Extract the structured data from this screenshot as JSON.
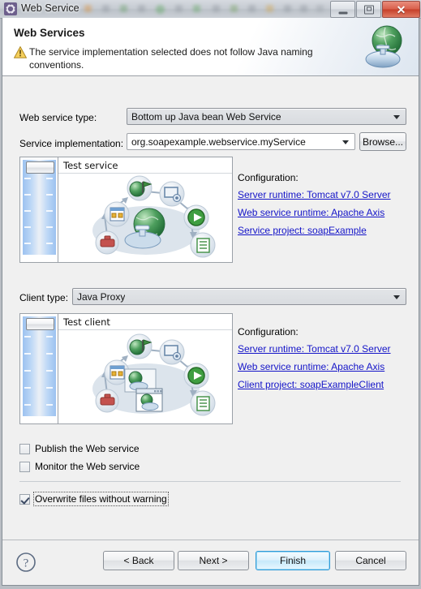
{
  "window": {
    "title": "Web Service",
    "title_icon": "gear-icon",
    "controls": {
      "minimize": "Minimize",
      "maximize": "Maximize",
      "close": "Close"
    }
  },
  "banner": {
    "title": "Web Services",
    "message": "The service implementation selected does not follow Java naming conventions.",
    "warning_icon": "warning-triangle-icon",
    "decoration_icon": "web-service-globe-icon"
  },
  "form": {
    "service_type_label": "Web service type:",
    "service_type_value": "Bottom up Java bean Web Service",
    "service_impl_label": "Service implementation:",
    "service_impl_value": "org.soapexample.webservice.myService",
    "browse_label": "Browse...",
    "client_type_label": "Client type:",
    "client_type_value": "Java Proxy"
  },
  "service_preview": {
    "group_title": "Test service",
    "slider_name": "service-generation-slider"
  },
  "client_preview": {
    "group_title": "Test client",
    "slider_name": "client-generation-slider"
  },
  "service_config": {
    "title": "Configuration:",
    "links": [
      "Server runtime: Tomcat v7.0 Server",
      "Web service runtime: Apache Axis",
      "Service project: soapExample"
    ]
  },
  "client_config": {
    "title": "Configuration:",
    "links": [
      "Server runtime: Tomcat v7.0 Server",
      "Web service runtime: Apache Axis",
      "Client project: soapExampleClient"
    ]
  },
  "options": {
    "publish": {
      "label": "Publish the Web service",
      "checked": false
    },
    "monitor": {
      "label": "Monitor the Web service",
      "checked": false
    },
    "overwrite": {
      "label": "Overwrite files without warning",
      "checked": true
    }
  },
  "footer": {
    "help_icon": "help-question-icon",
    "back_label": "< Back",
    "next_label": "Next >",
    "finish_label": "Finish",
    "cancel_label": "Cancel",
    "default_button": "Finish"
  },
  "colors": {
    "link": "#1414c8",
    "default_button_border": "#2f9bd8",
    "close_button": "#c63f29",
    "dialog_bg": "#f0f0f0",
    "banner_bg": "#ffffff"
  }
}
